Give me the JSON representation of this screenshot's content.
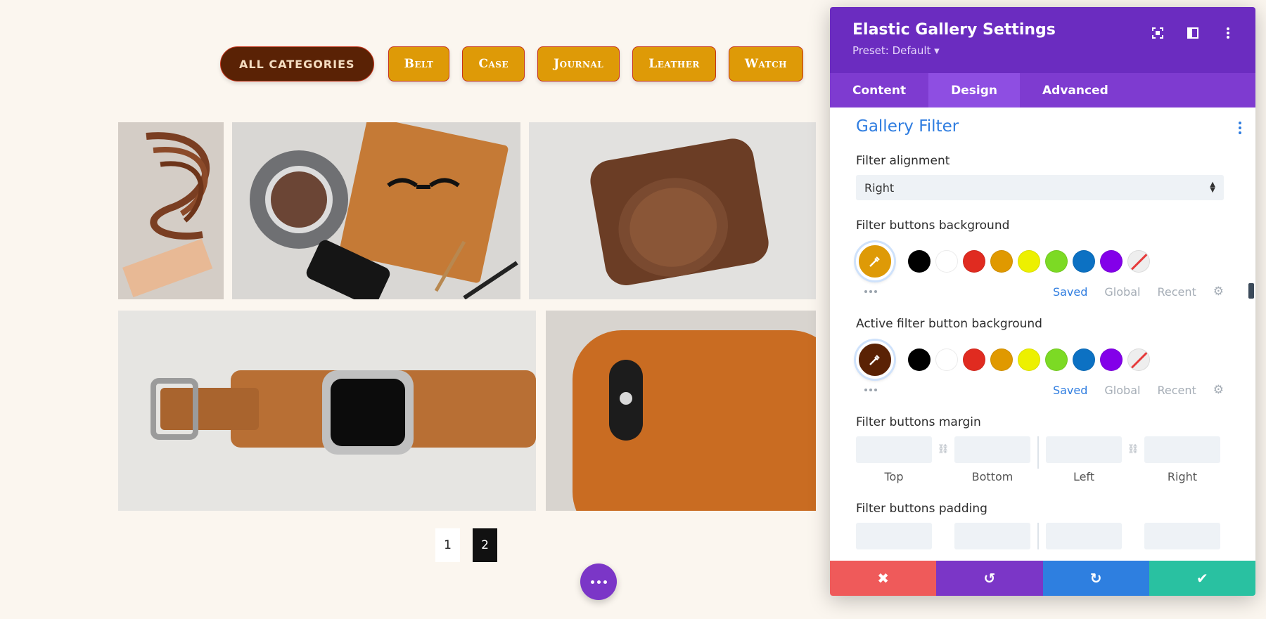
{
  "page": {
    "filters": [
      {
        "label": "ALL CATEGORIES",
        "active": true
      },
      {
        "label": "Belt",
        "active": false
      },
      {
        "label": "Case",
        "active": false
      },
      {
        "label": "Journal",
        "active": false
      },
      {
        "label": "Leather",
        "active": false
      },
      {
        "label": "Watch",
        "active": false
      }
    ],
    "pagination": [
      "1",
      "2"
    ],
    "current_page": "2"
  },
  "panel": {
    "title": "Elastic Gallery Settings",
    "preset": "Preset: Default ▾",
    "icons": [
      "fullscreen-icon",
      "split-view-icon",
      "more-icon"
    ],
    "tabs": [
      "Content",
      "Design",
      "Advanced"
    ],
    "active_tab": "Design",
    "section_title": "Gallery Filter",
    "filter_alignment": {
      "label": "Filter alignment",
      "value": "Right"
    },
    "filter_bg": {
      "label": "Filter buttons background",
      "color": "#de9a07"
    },
    "active_filter_bg": {
      "label": "Active filter button background",
      "color": "#5a2205"
    },
    "palette": [
      "#000000",
      "#ffffff",
      "#e02b20",
      "#e09900",
      "#edf000",
      "#7cda24",
      "#0c71c3",
      "#8300e9"
    ],
    "palette_tabs": [
      "Saved",
      "Global",
      "Recent"
    ],
    "margin": {
      "label": "Filter buttons margin",
      "fields": [
        "Top",
        "Bottom",
        "Left",
        "Right"
      ]
    },
    "padding": {
      "label": "Filter buttons padding"
    },
    "footer": {
      "cancel": "✖",
      "undo": "↺",
      "redo": "↻",
      "save": "✔"
    }
  }
}
